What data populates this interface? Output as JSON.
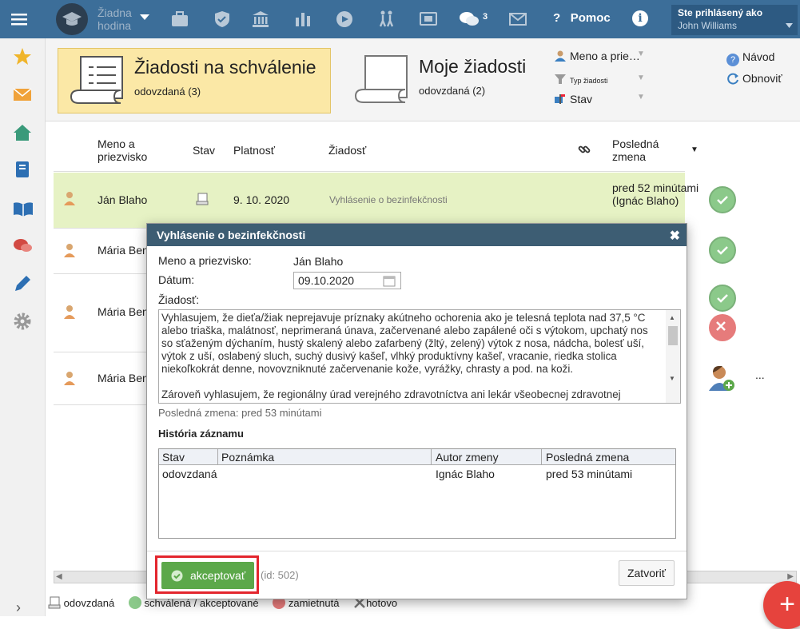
{
  "topbar": {
    "hour_label": "Žiadna hodina",
    "message_count": "3",
    "help_label": "Pomoc",
    "info_glyph": "i",
    "signed_in_label": "Ste prihlásený ako",
    "user_name": "John Williams"
  },
  "tabs": [
    {
      "title": "Žiadosti na schválenie",
      "subtitle": "odovzdaná (3)"
    },
    {
      "title": "Moje žiadosti",
      "subtitle": "odovzdaná (2)"
    }
  ],
  "filters": {
    "name": "Meno a prie…",
    "type": "Typ žiadosti",
    "status": "Stav"
  },
  "right_links": {
    "guide": "Návod",
    "refresh": "Obnoviť"
  },
  "table": {
    "headers": {
      "name": "Meno a priezvisko",
      "status": "Stav",
      "validity": "Platnosť",
      "request": "Žiadosť",
      "last_change": "Posledná zmena"
    },
    "rows": [
      {
        "name": "Ján Blaho",
        "date": "9. 10. 2020",
        "request": "Vyhlásenie o bezinfekčnosti",
        "last_change": "pred 52 minútami (Ignác Blaho)"
      },
      {
        "name": "Mária Ben"
      },
      {
        "name": "Mária Ben"
      },
      {
        "name": "Mária Ben",
        "more": "..."
      }
    ]
  },
  "legend": {
    "submitted": "odovzdaná",
    "approved": "schválená / akceptované",
    "rejected": "zamietnutá",
    "done": "hotovo"
  },
  "modal": {
    "title": "Vyhlásenie o bezinfekčnosti",
    "close_glyph": "✖",
    "name_label": "Meno a priezvisko:",
    "name_value": "Ján Blaho",
    "date_label": "Dátum:",
    "date_value": "09.10.2020",
    "request_label": "Žiadosť:",
    "request_p1": "Vyhlasujem, že dieťa/žiak neprejavuje príznaky akútneho ochorenia ako je telesná teplota nad 37,5 °C alebo triaška, malátnosť, neprimeraná únava, začervenané alebo zapálené oči s výtokom, upchatý nos so sťaženým dýchaním, hustý skalený alebo zafarbený (žltý, zelený) výtok z nosa, nádcha, bolesť uší, výtok z uší, oslabený sluch, suchý dusivý kašeľ, vlhký produktívny kašeľ, vracanie, riedka stolica niekoľkokrát denne, novovzniknuté začervenanie kože, vyrážky, chrasty a pod. na koži.",
    "request_p2": "Zároveň vyhlasujem, že regionálny úrad verejného zdravotníctva ani lekár všeobecnej zdravotnej starostlivosti pre deti a dorast nenariadil dieťaťu/žiakovi karanténne opatrenie (karanténu",
    "last_change": "Posledná zmena: pred 53 minútami",
    "history_title": "História záznamu",
    "history_headers": [
      "Stav",
      "Poznámka",
      "Autor zmeny",
      "Posledná zmena"
    ],
    "history_rows": [
      [
        "odovzdaná",
        "",
        "Ignác Blaho",
        "pred 53 minútami"
      ]
    ],
    "accept_label": "akceptovať",
    "id_label": "(id: 502)",
    "close_label": "Zatvoriť"
  },
  "fab_glyph": "+",
  "colors": {
    "accent": "#3c6e99",
    "active_tab": "#fbe8a6",
    "selected_row": "#e6f2c4",
    "accept": "#5ca84a",
    "highlight": "#e3262d",
    "fab": "#e6433d"
  }
}
